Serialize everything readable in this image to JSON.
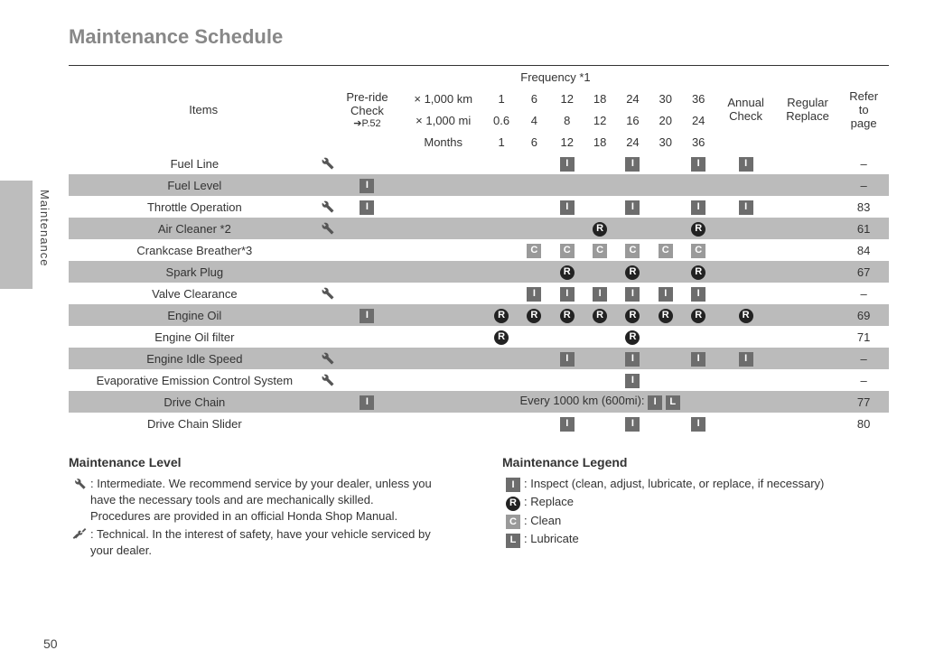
{
  "title": "Maintenance Schedule",
  "side_label": "Maintenance",
  "page_number": "50",
  "header": {
    "items": "Items",
    "preride": "Pre-ride\nCheck",
    "preride_ref": "P.52",
    "frequency": "Frequency *1",
    "x1000km": "× 1,000 km",
    "x1000mi": "× 1,000 mi",
    "months": "Months",
    "annual": "Annual\nCheck",
    "regular": "Regular\nReplace",
    "refer": "Refer\nto\npage",
    "km_vals": [
      "1",
      "6",
      "12",
      "18",
      "24",
      "30",
      "36"
    ],
    "mi_vals": [
      "0.6",
      "4",
      "8",
      "12",
      "16",
      "20",
      "24"
    ],
    "mo_vals": [
      "1",
      "6",
      "12",
      "18",
      "24",
      "30",
      "36"
    ]
  },
  "rows": [
    {
      "name": "Fuel Line",
      "tool": "inter",
      "pre": "",
      "f": [
        "",
        "",
        "I",
        "",
        "I",
        "",
        "I"
      ],
      "annual": "I",
      "reg": "",
      "page": "–",
      "shade": false
    },
    {
      "name": "Fuel Level",
      "tool": "",
      "pre": "I",
      "f": [
        "",
        "",
        "",
        "",
        "",
        "",
        ""
      ],
      "annual": "",
      "reg": "",
      "page": "–",
      "shade": true
    },
    {
      "name": "Throttle Operation",
      "tool": "inter",
      "pre": "I",
      "f": [
        "",
        "",
        "I",
        "",
        "I",
        "",
        "I"
      ],
      "annual": "I",
      "reg": "",
      "page": "83",
      "shade": false
    },
    {
      "name": "Air Cleaner *2",
      "tool": "inter",
      "pre": "",
      "f": [
        "",
        "",
        "",
        "R",
        "",
        "",
        "R"
      ],
      "annual": "",
      "reg": "",
      "page": "61",
      "shade": true
    },
    {
      "name": "Crankcase Breather*3",
      "tool": "",
      "pre": "",
      "f": [
        "",
        "C",
        "C",
        "C",
        "C",
        "C",
        "C"
      ],
      "annual": "",
      "reg": "",
      "page": "84",
      "shade": false
    },
    {
      "name": "Spark Plug",
      "tool": "",
      "pre": "",
      "f": [
        "",
        "",
        "R",
        "",
        "R",
        "",
        "R"
      ],
      "annual": "",
      "reg": "",
      "page": "67",
      "shade": true
    },
    {
      "name": "Valve Clearance",
      "tool": "inter",
      "pre": "",
      "f": [
        "",
        "I",
        "I",
        "I",
        "I",
        "I",
        "I"
      ],
      "annual": "",
      "reg": "",
      "page": "–",
      "shade": false
    },
    {
      "name": "Engine Oil",
      "tool": "",
      "pre": "I",
      "f": [
        "R",
        "R",
        "R",
        "R",
        "R",
        "R",
        "R"
      ],
      "annual": "R",
      "reg": "",
      "page": "69",
      "shade": true
    },
    {
      "name": "Engine Oil filter",
      "tool": "",
      "pre": "",
      "f": [
        "R",
        "",
        "",
        "",
        "R",
        "",
        ""
      ],
      "annual": "",
      "reg": "",
      "page": "71",
      "shade": false
    },
    {
      "name": "Engine Idle Speed",
      "tool": "inter",
      "pre": "",
      "f": [
        "",
        "",
        "I",
        "",
        "I",
        "",
        "I"
      ],
      "annual": "I",
      "reg": "",
      "page": "–",
      "shade": true
    },
    {
      "name": "Evaporative Emission Control System",
      "tool": "inter",
      "pre": "",
      "f": [
        "",
        "",
        "",
        "",
        "I",
        "",
        ""
      ],
      "annual": "",
      "reg": "",
      "page": "–",
      "shade": false
    }
  ],
  "drive_chain": {
    "name": "Drive Chain",
    "pre": "I",
    "note_prefix": "Every 1000 km (600mi): ",
    "badges": [
      "I",
      "L"
    ],
    "page": "77",
    "shade": true
  },
  "drive_chain_slider": {
    "name": "Drive Chain Slider",
    "f": [
      "",
      "",
      "I",
      "",
      "I",
      "",
      "I"
    ],
    "page": "80",
    "shade": false
  },
  "legend_level": {
    "title": "Maintenance Level",
    "inter": "Intermediate. We recommend service by your dealer, unless you have the necessary tools and are mechanically skilled.",
    "inter2": "Procedures are provided in an official Honda Shop Manual.",
    "tech": "Technical. In the interest of safety, have your vehicle serviced by your dealer."
  },
  "legend_symbols": {
    "title": "Maintenance Legend",
    "I": "Inspect (clean, adjust, lubricate, or replace, if necessary)",
    "R": "Replace",
    "C": "Clean",
    "L": "Lubricate"
  }
}
